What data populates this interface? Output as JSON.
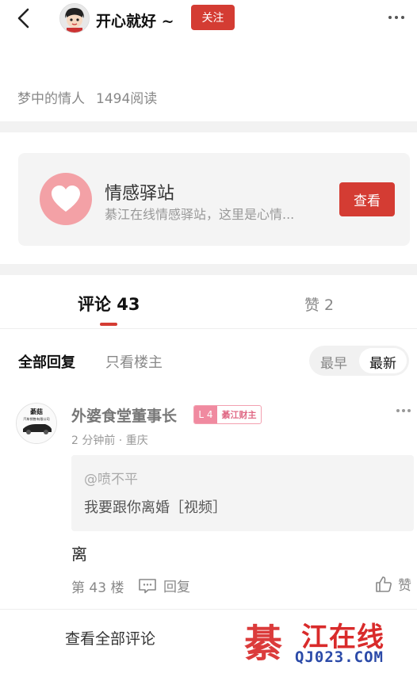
{
  "header": {
    "author_name": "开心就好 ~",
    "follow_label": "关注"
  },
  "post_meta": {
    "title": "梦中的情人",
    "reads": "1494阅读"
  },
  "promo_card": {
    "title": "情感驿站",
    "description": "綦江在线情感驿站，这里是心情...",
    "button_label": "查看",
    "accent": "#d43c33",
    "icon_bg": "#f3a1a6"
  },
  "tabs": {
    "comments": "评论 43",
    "likes": "赞 2"
  },
  "filters": {
    "all_replies": "全部回复",
    "owner_only": "只看楼主",
    "sort_earliest": "最早",
    "sort_newest": "最新"
  },
  "comment": {
    "username": "外婆食堂董事长",
    "level": "L 4",
    "level_title": "綦江财主",
    "time_location": "2 分钟前 · 重庆",
    "quoted_user": "@喷不平",
    "quoted_text": "我要跟你离婚［视频］",
    "body": "离",
    "floor": "第 43 楼",
    "reply_label": "回复",
    "like_label": "赞",
    "avatar_text_top": "綦菇",
    "avatar_text_sub": "汽车销售有限公司"
  },
  "footer": {
    "view_all": "查看全部评论"
  },
  "watermark": {
    "char": "綦",
    "name": "江在线",
    "url": "QJ023.COM"
  }
}
